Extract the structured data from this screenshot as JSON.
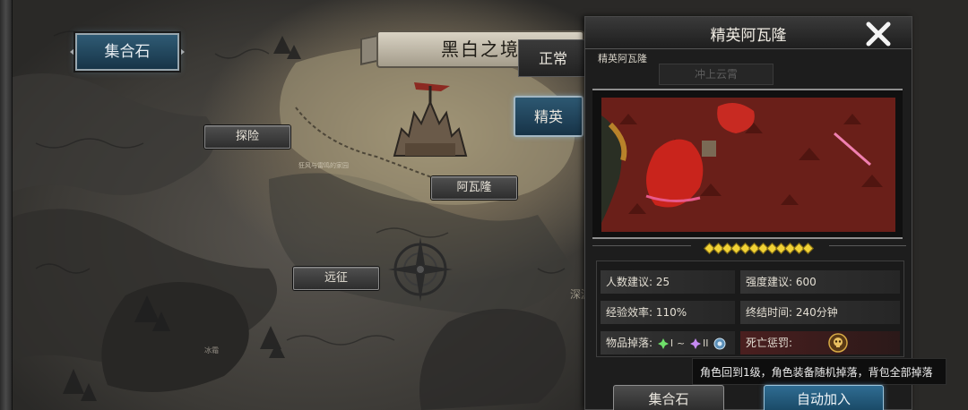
{
  "map": {
    "region_title": "黑白之境",
    "gather_stone_label": "集合石",
    "locations": {
      "explore": "探险",
      "arwalon": "阿瓦隆",
      "expedition": "远征"
    },
    "small_labels": {
      "near_explore": "狂风与雷鸣的家园",
      "lower_left": "冰霜",
      "right_edge": "深渊之地"
    }
  },
  "mode_tabs": {
    "normal": "正常",
    "elite": "精英"
  },
  "panel": {
    "title": "精英阿瓦隆",
    "subtitle": "精英阿瓦隆",
    "faded_label": "冲上云霄",
    "difficulty_stars": 12,
    "stats": {
      "players_label": "人数建议:",
      "players_value": "25",
      "strength_label": "强度建议:",
      "strength_value": "600",
      "exp_label": "经验效率:",
      "exp_value": "110%",
      "end_time_label": "终结时间:",
      "end_time_value": "240分钟",
      "drops_label": "物品掉落:",
      "drops_tier_low": "I",
      "drops_range_sep": "~",
      "drops_tier_high": "II",
      "death_label": "死亡惩罚:"
    },
    "death_tooltip": "角色回到1级，角色装备随机掉落，背包全部掉落",
    "gather_button": "集合石",
    "auto_join_button": "自动加入"
  },
  "icons": {
    "close": "close-icon",
    "green_gem": "green-gem-icon",
    "purple_gem": "purple-gem-icon",
    "blue_gem": "blue-gem-icon",
    "skull": "skull-icon",
    "compass": "compass-rose-icon",
    "castle": "castle-icon"
  },
  "colors": {
    "accent_blue": "#2d5872",
    "star_gold": "#f1d236",
    "death_red": "#4a1f1f"
  }
}
